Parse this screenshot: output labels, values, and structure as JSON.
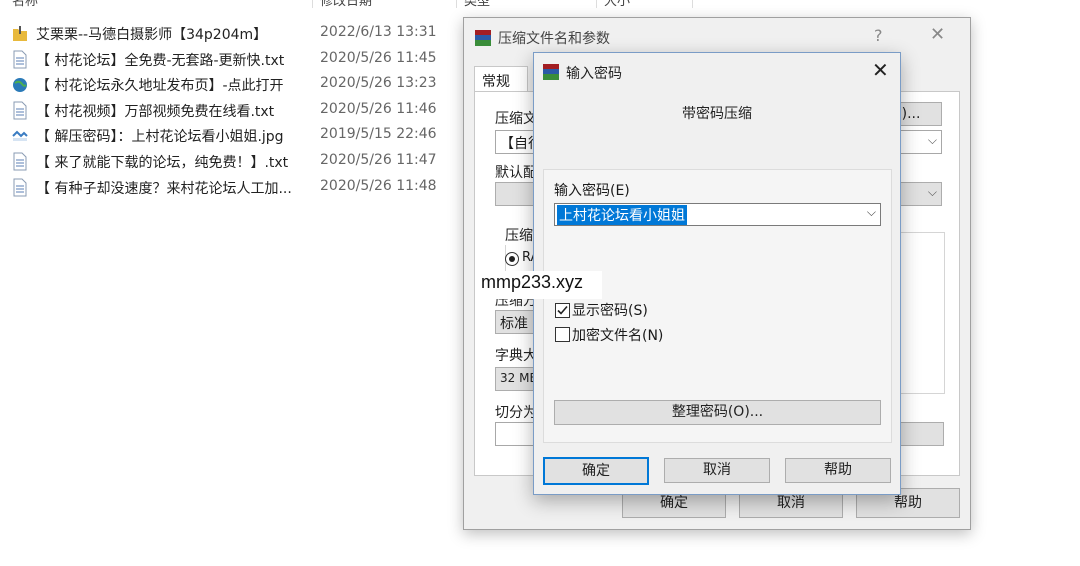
{
  "explorer": {
    "columns": {
      "name": "名称",
      "date": "修改日期",
      "type": "类型",
      "size": "大小"
    },
    "files": [
      {
        "icon": "folder-zip-icon",
        "name": "艾栗栗--马德白摄影师【34p204m】",
        "date": "2022/6/13 13:31"
      },
      {
        "icon": "txt-file-icon",
        "name": "【 村花论坛】全免费-无套路-更新快.txt",
        "date": "2020/5/26 11:45"
      },
      {
        "icon": "url-shortcut-icon",
        "name": "【 村花论坛永久地址发布页】-点此打开",
        "date": "2020/5/26 13:23"
      },
      {
        "icon": "txt-file-icon",
        "name": "【 村花视频】万部视频免费在线看.txt",
        "date": "2020/5/26 11:46"
      },
      {
        "icon": "image-file-icon",
        "name": "【 解压密码】：上村花论坛看小姐姐.jpg",
        "date": "2019/5/15 22:46"
      },
      {
        "icon": "txt-file-icon",
        "name": "【 来了就能下载的论坛，纯免费！】.txt",
        "date": "2020/5/26 11:47"
      },
      {
        "icon": "txt-file-icon",
        "name": "【 有种子却没速度？来村花论坛人工加...",
        "date": "2020/5/26 11:48"
      }
    ]
  },
  "archive_dialog": {
    "title": "压缩文件名和参数",
    "help": "?",
    "close": "✕",
    "tab_general": "常规",
    "archive_name_label": "压缩文",
    "archive_name_value": "【自行",
    "browse_button": "(B)...",
    "default_profile_label": "默认配",
    "format_label": "压缩",
    "format_option": "RA",
    "method_label": "压缩方",
    "method_value": "标准",
    "dict_label": "字典大",
    "dict_value": "32 MB",
    "split_label": "切分为",
    "ok": "确定",
    "cancel": "取消",
    "help_button": "帮助"
  },
  "password_dialog": {
    "title": "输入密码",
    "close": "✕",
    "subtitle": "带密码压缩",
    "password_label": "输入密码(E)",
    "password_value": "上村花论坛看小姐姐",
    "show_password_label": "显示密码(S)",
    "show_password_checked": true,
    "encrypt_names_label": "加密文件名(N)",
    "encrypt_names_checked": false,
    "organize_button": "整理密码(O)...",
    "ok": "确定",
    "cancel": "取消",
    "help_button": "帮助"
  },
  "watermark": "mmp233.xyz",
  "colors": {
    "selection": "#0078d7",
    "focus_border": "#0078d7",
    "winrar_red": "#a31e22"
  }
}
